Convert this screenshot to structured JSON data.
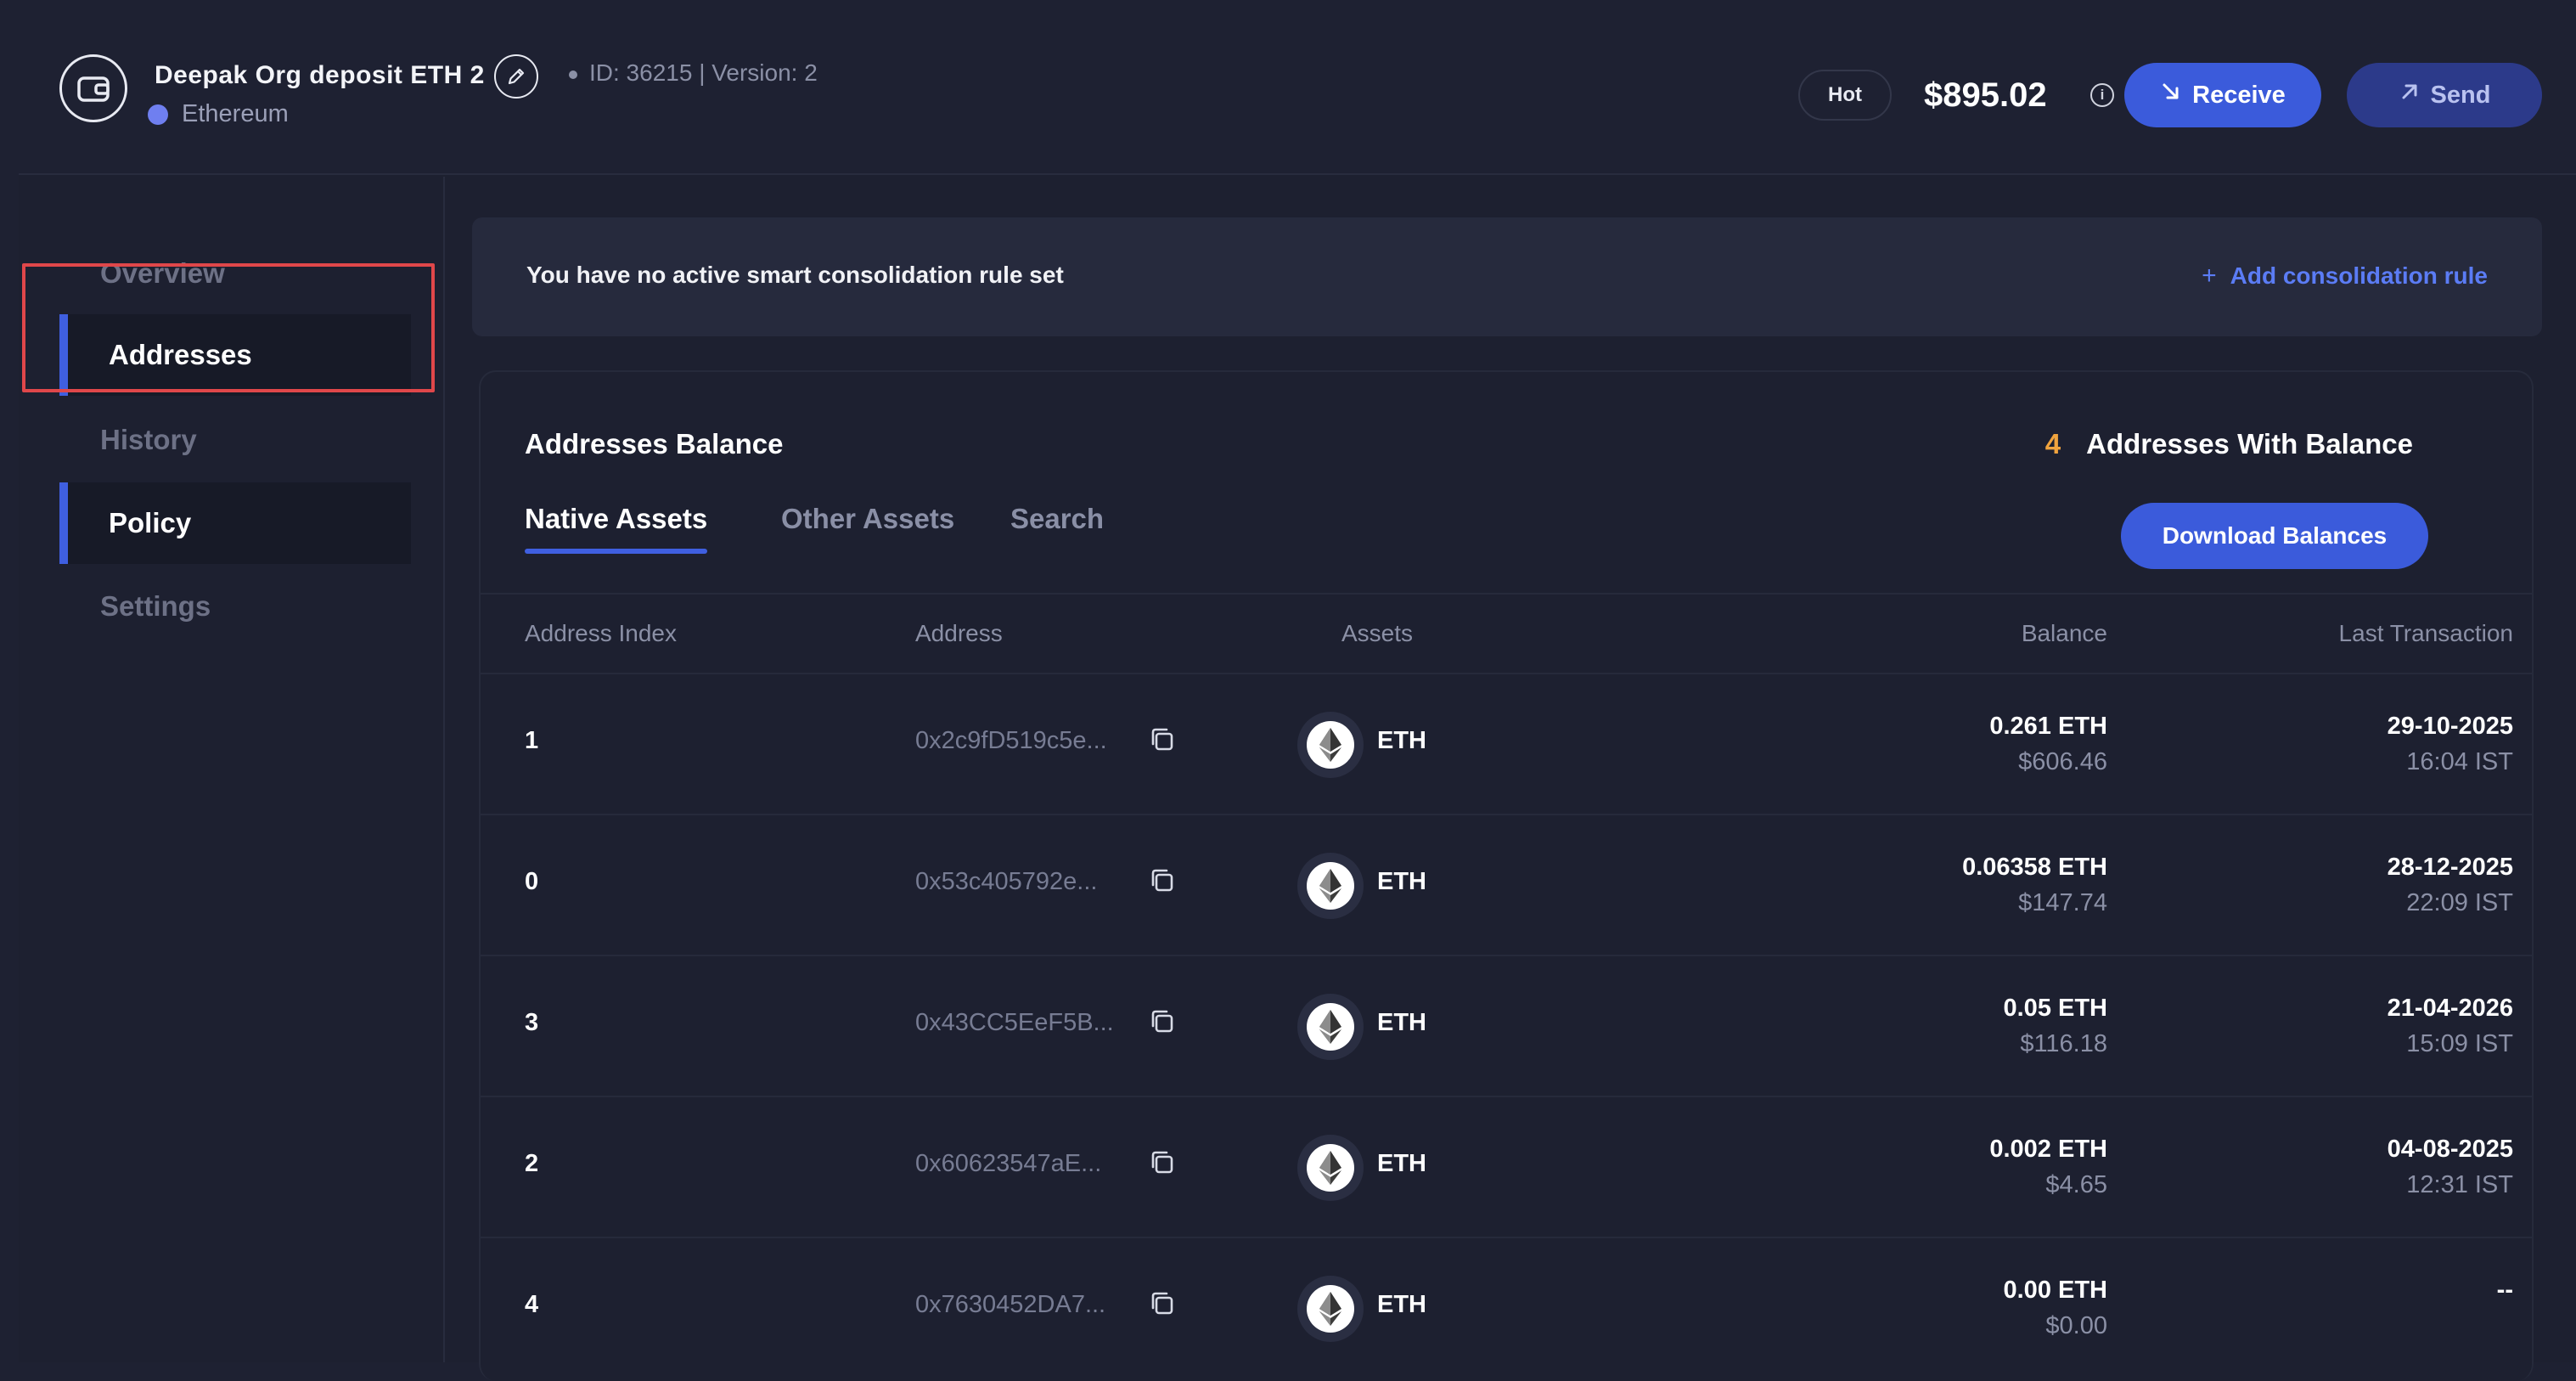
{
  "header": {
    "wallet_name": "Deepak Org deposit ETH 2",
    "meta": "ID: 36215 | Version: 2",
    "chain": "Ethereum",
    "wallet_type": "Hot",
    "balance": "$895.02",
    "receive_label": "Receive",
    "send_label": "Send"
  },
  "sidebar": {
    "items": [
      {
        "label": "Overview"
      },
      {
        "label": "Addresses"
      },
      {
        "label": "History"
      },
      {
        "label": "Policy"
      },
      {
        "label": "Settings"
      }
    ]
  },
  "consolidation": {
    "message": "You have no active smart consolidation rule set",
    "add_label": "Add consolidation rule"
  },
  "panel": {
    "title": "Addresses Balance",
    "addresses_with_balance_count": "4",
    "addresses_with_balance_label": "Addresses With Balance",
    "tabs": [
      {
        "label": "Native Assets"
      },
      {
        "label": "Other Assets"
      },
      {
        "label": "Search"
      }
    ],
    "download_label": "Download Balances"
  },
  "table": {
    "columns": [
      "Address Index",
      "Address",
      "Assets",
      "Balance",
      "Last Transaction"
    ],
    "rows": [
      {
        "index": "1",
        "address": "0x2c9fD519c5e...",
        "asset": "ETH",
        "balance": "0.261 ETH",
        "usd": "$606.46",
        "date": "29-10-2025",
        "time": "16:04 IST"
      },
      {
        "index": "0",
        "address": "0x53c405792e...",
        "asset": "ETH",
        "balance": "0.06358 ETH",
        "usd": "$147.74",
        "date": "28-12-2025",
        "time": "22:09 IST"
      },
      {
        "index": "3",
        "address": "0x43CC5EeF5B...",
        "asset": "ETH",
        "balance": "0.05 ETH",
        "usd": "$116.18",
        "date": "21-04-2026",
        "time": "15:09 IST"
      },
      {
        "index": "2",
        "address": "0x60623547aE...",
        "asset": "ETH",
        "balance": "0.002 ETH",
        "usd": "$4.65",
        "date": "04-08-2025",
        "time": "12:31 IST"
      },
      {
        "index": "4",
        "address": "0x7630452DA7...",
        "asset": "ETH",
        "balance": "0.00 ETH",
        "usd": "$0.00",
        "date": "--",
        "time": ""
      }
    ]
  },
  "colors": {
    "accent": "#3b5bdb",
    "highlight": "#e0474a",
    "count": "#f0a33e"
  }
}
